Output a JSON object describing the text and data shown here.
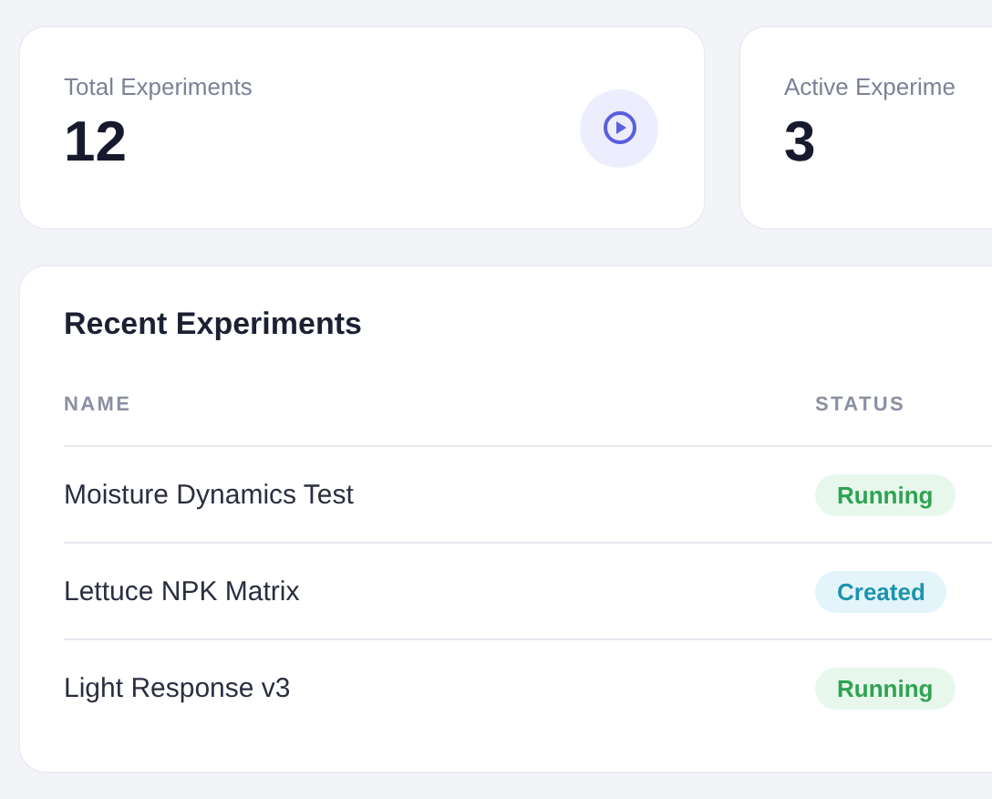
{
  "stats": [
    {
      "label": "Total Experiments",
      "value": "12",
      "kind": "with_icon"
    },
    {
      "label": "Active Experime",
      "value": "3",
      "kind": "plain"
    }
  ],
  "recent": {
    "title": "Recent Experiments",
    "columns": [
      "NAME",
      "STATUS"
    ],
    "rows": [
      {
        "name": "Moisture Dynamics Test",
        "status": "Running",
        "kind": "running"
      },
      {
        "name": "Lettuce NPK Matrix",
        "status": "Created",
        "kind": "created"
      },
      {
        "name": "Light Response v3",
        "status": "Running",
        "kind": "running"
      }
    ]
  }
}
